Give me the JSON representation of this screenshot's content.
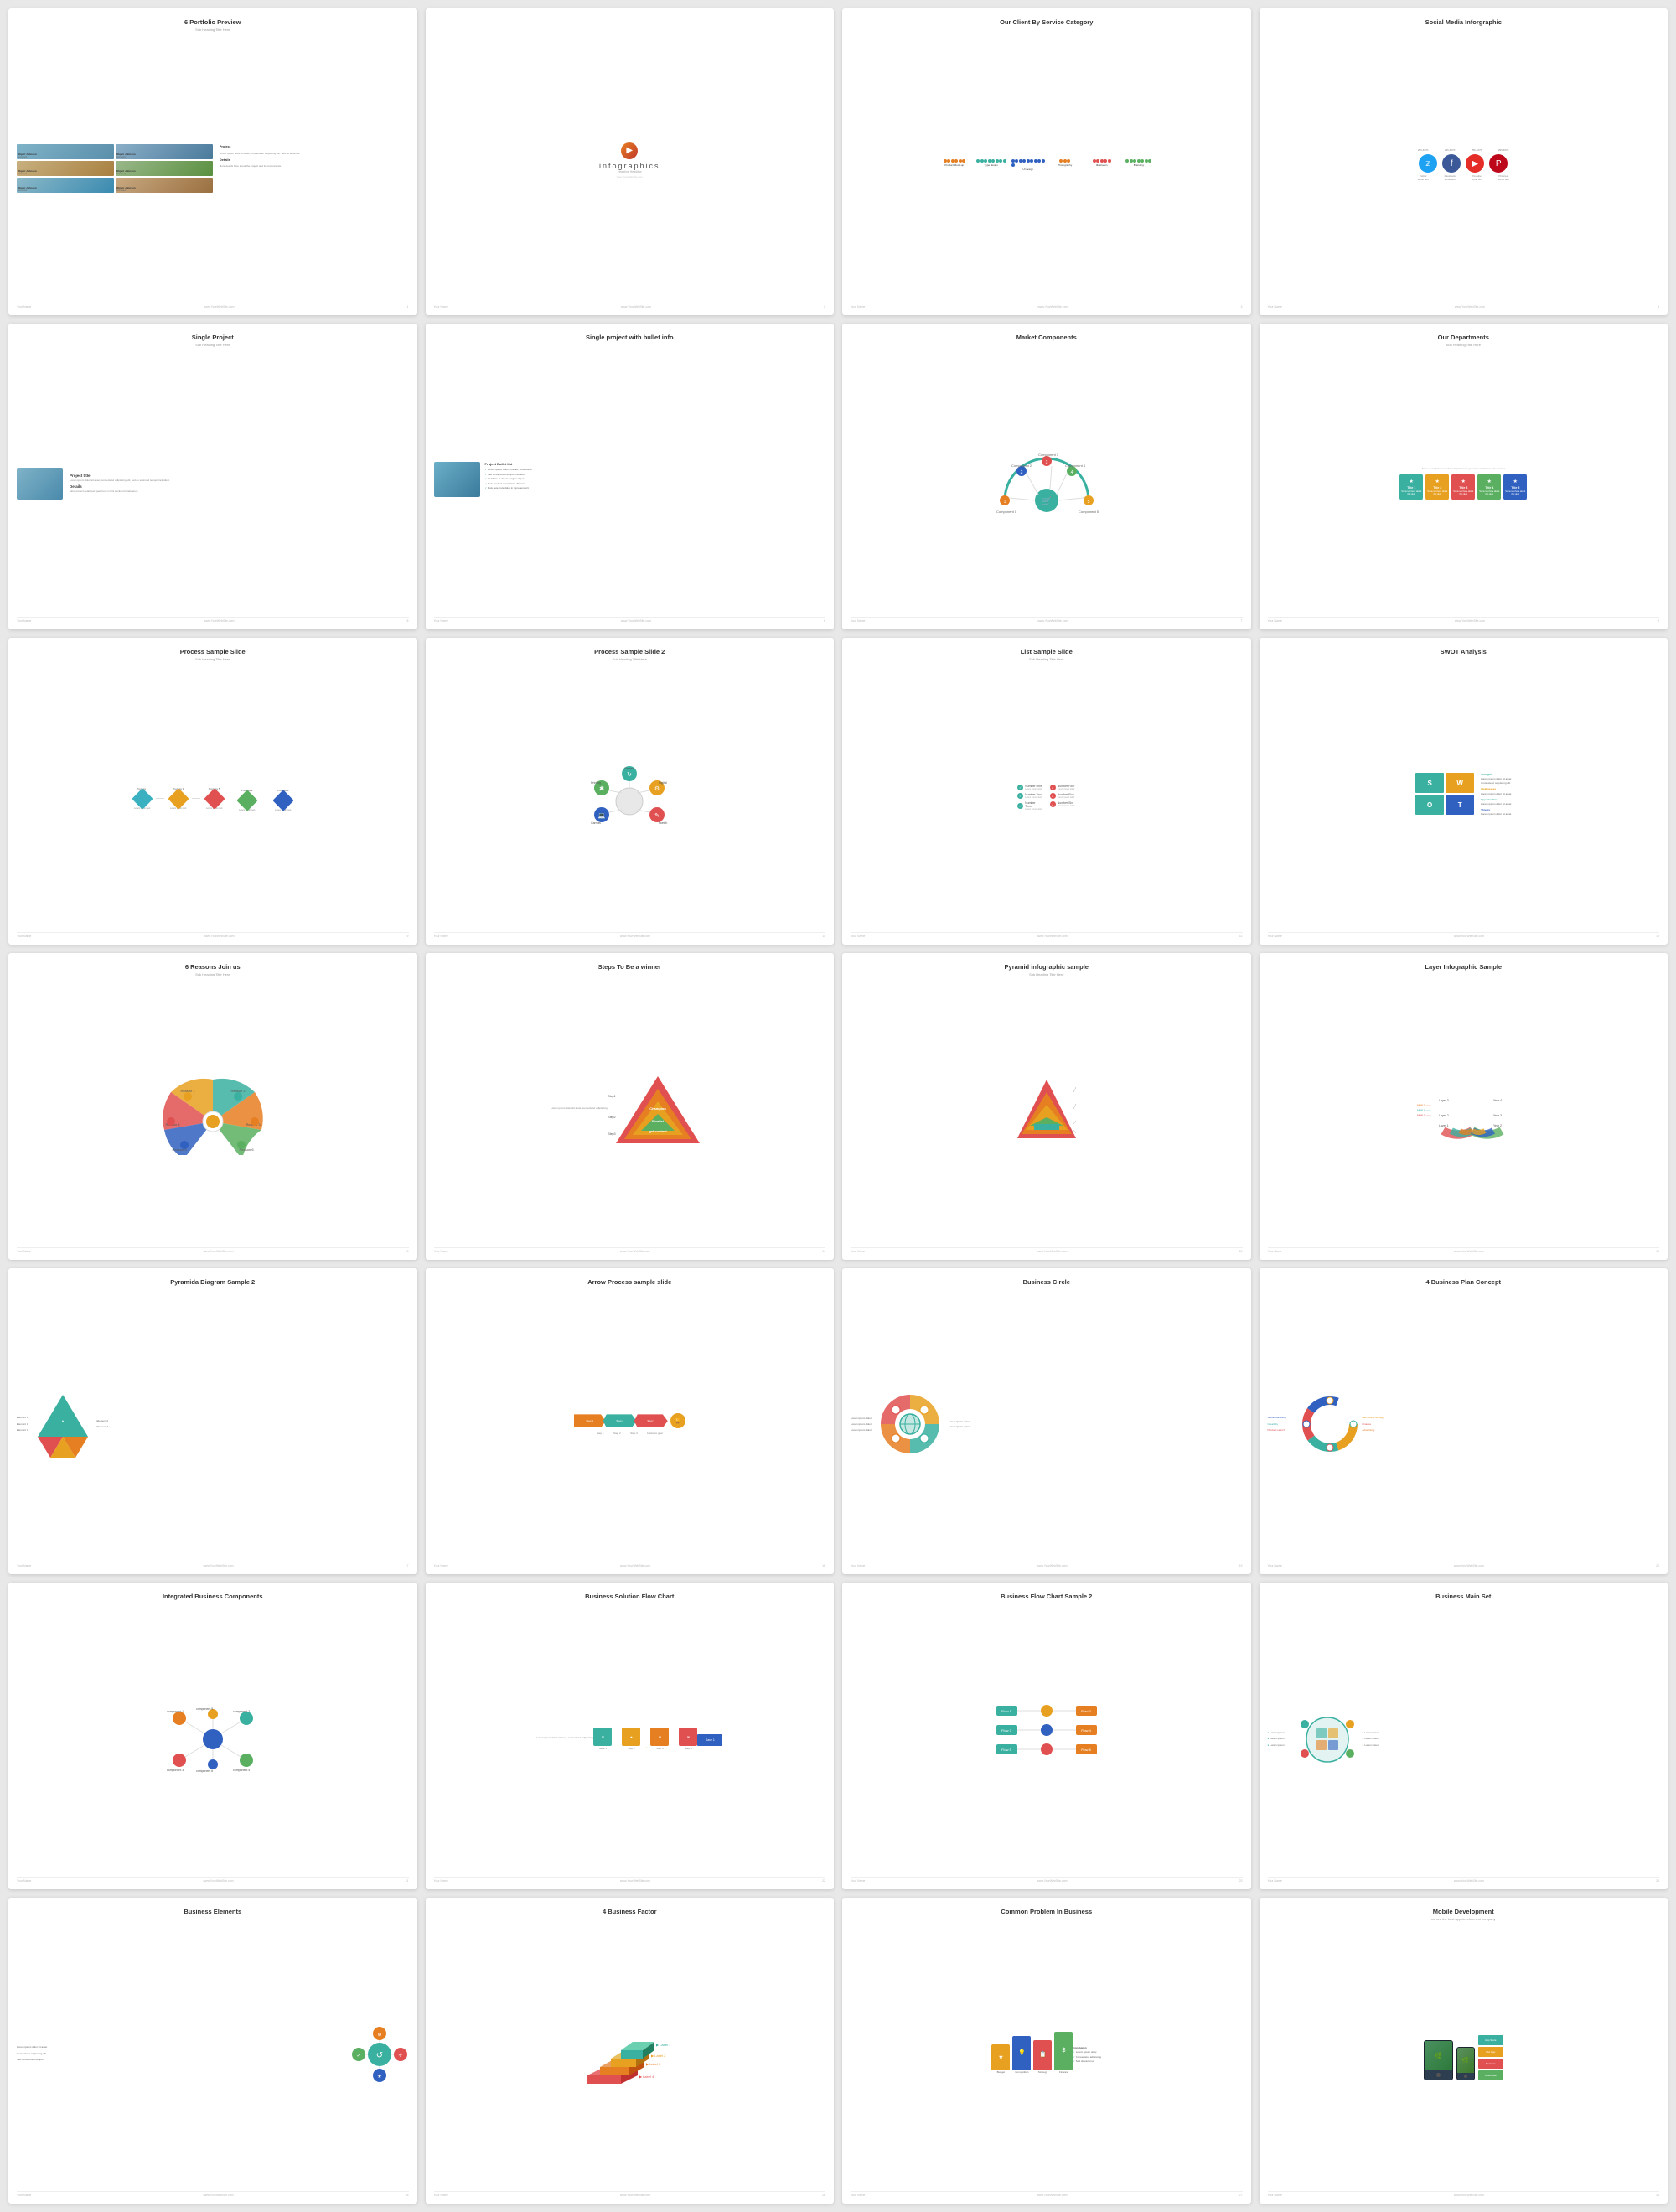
{
  "slides": [
    {
      "id": "portfolio-preview",
      "title": "6 Portfolio Preview",
      "sub": "Sub Heading Title Here",
      "footer_left": "Your Name",
      "footer_right": "www.YourWebSite.com",
      "type": "portfolio"
    },
    {
      "id": "infographics",
      "title": "infographics",
      "sub": "Headline Headline",
      "footer_left": "Your Name",
      "footer_right": "www.YourWebSite.com",
      "type": "infographics"
    },
    {
      "id": "client-category",
      "title": "Our Client By Service Category",
      "sub": "",
      "footer_left": "Your Name",
      "footer_right": "www.YourWebSite.com",
      "type": "client-category"
    },
    {
      "id": "social-media",
      "title": "Social Media Inforgraphic",
      "sub": "",
      "footer_left": "Your Name",
      "footer_right": "www.YourWebSite.com",
      "type": "social-media"
    },
    {
      "id": "single-project",
      "title": "Single Project",
      "sub": "Sub Heading Title Here",
      "footer_left": "Your Name",
      "footer_right": "www.YourWebSite.com",
      "type": "single-project"
    },
    {
      "id": "single-project-bullet",
      "title": "Single project with bullet info",
      "sub": "",
      "footer_left": "Your Name",
      "footer_right": "www.YourWebSite.com",
      "type": "single-project-bullet"
    },
    {
      "id": "market-components",
      "title": "Market Components",
      "sub": "",
      "footer_left": "Your Name",
      "footer_right": "www.YourWebSite.com",
      "type": "market-components"
    },
    {
      "id": "our-departments",
      "title": "Our Departments",
      "sub": "",
      "footer_left": "Your Name",
      "footer_right": "www.YourWebSite.com",
      "type": "our-departments"
    },
    {
      "id": "process-sample",
      "title": "Process Sample Slide",
      "sub": "Sub Heading Title Here",
      "footer_left": "Your Name",
      "footer_right": "www.YourWebSite.com",
      "type": "process-sample"
    },
    {
      "id": "process-sample-2",
      "title": "Process Sample Slide 2",
      "sub": "Sub Heading Title Here",
      "footer_left": "Your Name",
      "footer_right": "www.YourWebSite.com",
      "type": "process-sample-2"
    },
    {
      "id": "list-sample",
      "title": "List Sample Slide",
      "sub": "Sub Heading Title Here",
      "footer_left": "Your Name",
      "footer_right": "www.YourWebSite.com",
      "type": "list-sample"
    },
    {
      "id": "swot",
      "title": "SWOT Analysis",
      "sub": "",
      "footer_left": "Your Name",
      "footer_right": "www.YourWebSite.com",
      "type": "swot"
    },
    {
      "id": "reasons-join",
      "title": "6 Reasons Join us",
      "sub": "Sub Heading Title Here",
      "footer_left": "Your Name",
      "footer_right": "www.YourWebSite.com",
      "type": "reasons-join"
    },
    {
      "id": "steps-winner",
      "title": "Steps To Be a winner",
      "sub": "",
      "footer_left": "Your Name",
      "footer_right": "www.YourWebSite.com",
      "type": "steps-winner"
    },
    {
      "id": "pyramid-infographic",
      "title": "Pyramid infographic sample",
      "sub": "Sub Heading Title Here",
      "footer_left": "Your Name",
      "footer_right": "www.YourWebSite.com",
      "type": "pyramid-infographic"
    },
    {
      "id": "layer-infographic",
      "title": "Layer Infographic Sample",
      "sub": "",
      "footer_left": "Your Name",
      "footer_right": "www.YourWebSite.com",
      "type": "layer-infographic"
    },
    {
      "id": "pyramida-diagram-2",
      "title": "Pyramida Diagram Sample 2",
      "sub": "",
      "footer_left": "Your Name",
      "footer_right": "www.YourWebSite.com",
      "type": "pyramida-2"
    },
    {
      "id": "arrow-process",
      "title": "Arrow Process sample slide",
      "sub": "",
      "footer_left": "Your Name",
      "footer_right": "www.YourWebSite.com",
      "type": "arrow-process"
    },
    {
      "id": "business-circle",
      "title": "Business Circle",
      "sub": "",
      "footer_left": "Your Name",
      "footer_right": "www.YourWebSite.com",
      "type": "business-circle"
    },
    {
      "id": "business-plan",
      "title": "4 Business Plan Concept",
      "sub": "",
      "footer_left": "Your Name",
      "footer_right": "www.YourWebSite.com",
      "type": "business-plan"
    },
    {
      "id": "integrated",
      "title": "Integrated Business Components",
      "sub": "",
      "footer_left": "Your Name",
      "footer_right": "www.YourWebSite.com",
      "type": "integrated"
    },
    {
      "id": "flow-chart",
      "title": "Business Solution Flow Chart",
      "sub": "",
      "footer_left": "Your Name",
      "footer_right": "www.YourWebSite.com",
      "type": "flow-chart"
    },
    {
      "id": "flow-chart-2",
      "title": "Business Flow Chart Sample 2",
      "sub": "",
      "footer_left": "Your Name",
      "footer_right": "www.YourWebSite.com",
      "type": "flow-chart-2"
    },
    {
      "id": "business-main-set",
      "title": "Business Main Set",
      "sub": "",
      "footer_left": "Your Name",
      "footer_right": "www.YourWebSite.com",
      "type": "business-main-set"
    },
    {
      "id": "business-elements",
      "title": "Business Elements",
      "sub": "",
      "footer_left": "Your Name",
      "footer_right": "www.YourWebSite.com",
      "type": "business-elements"
    },
    {
      "id": "business-factor",
      "title": "4 Business Factor",
      "sub": "",
      "footer_left": "Your Name",
      "footer_right": "www.YourWebSite.com",
      "type": "business-factor"
    },
    {
      "id": "common-problem",
      "title": "Common Problem In Business",
      "sub": "",
      "footer_left": "Your Name",
      "footer_right": "www.YourWebSite.com",
      "type": "common-problem"
    },
    {
      "id": "mobile-development",
      "title": "Mobile Development",
      "sub": "",
      "footer_left": "Your Name",
      "footer_right": "www.YourWebSite.com",
      "type": "mobile-dev"
    }
  ]
}
